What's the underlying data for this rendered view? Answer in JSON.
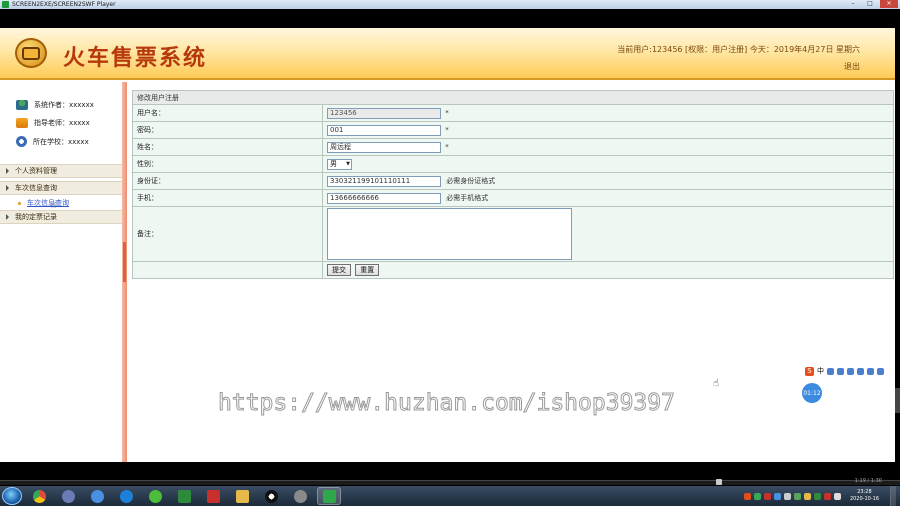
{
  "player": {
    "title": "SCREEN2EXE/SCREEN2SWF Player",
    "btn_min": "–",
    "btn_max": "□",
    "btn_close": "✕"
  },
  "header": {
    "app_title": "火车售票系统",
    "user_info": "当前用户:123456 [权限：用户注册] 今天：2019年4月27日 星期六",
    "logout": "退出"
  },
  "sidebar": {
    "info": [
      {
        "label": "系统作者：xxxxxx"
      },
      {
        "label": "指导老师：xxxxx"
      },
      {
        "label": "所在学校：xxxxx"
      }
    ],
    "menus": [
      {
        "label": "个人资料管理"
      },
      {
        "label": "车次信息查询"
      },
      {
        "label": "我的定票记录"
      }
    ],
    "submenu": "车次信息查询"
  },
  "form": {
    "header": "修改用户注册",
    "fields": {
      "username": {
        "label": "用户名：",
        "value": "123456",
        "req": "*"
      },
      "password": {
        "label": "密码：",
        "value": "001",
        "req": "*"
      },
      "name": {
        "label": "姓名：",
        "value": "周远程",
        "req": "*"
      },
      "gender": {
        "label": "性别：",
        "value": "男"
      },
      "idcard": {
        "label": "身份证：",
        "value": "330321199101110111",
        "hint": "必需身份证格式"
      },
      "phone": {
        "label": "手机：",
        "value": "13666666666",
        "hint": "必需手机格式"
      },
      "remark": {
        "label": "备注：",
        "value": ""
      }
    },
    "submit_label": "提交",
    "reset_label": "重置"
  },
  "overlay": {
    "watermark": "https://www.huzhan.com/ishop39397",
    "ime_logo": "S",
    "ime_lang": "中",
    "timer": "01:12"
  },
  "player_bottom": {
    "seek_time": "1:19 / 1:30"
  },
  "taskbar": {
    "time": "23:28",
    "date": "2020-10-16"
  },
  "colors": {
    "title_red": "#b6380b",
    "header_gold": "#fdcb56",
    "form_bg": "#eef7f2",
    "link_blue": "#3355cc"
  }
}
